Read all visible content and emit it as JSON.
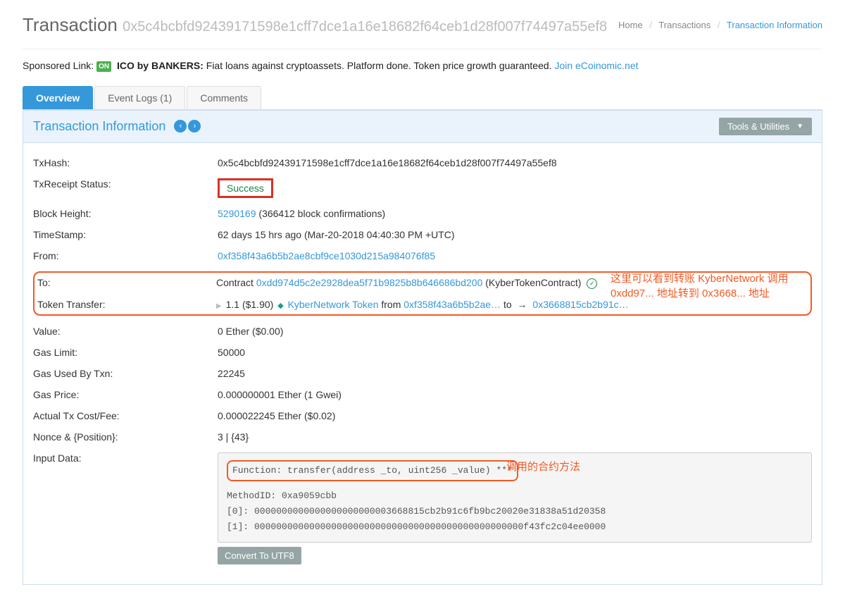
{
  "header": {
    "title_prefix": "Transaction",
    "hash": "0x5c4bcbfd92439171598e1cff7dce1a16e18682f64ceb1d28f007f74497a55ef8"
  },
  "breadcrumb": {
    "home": "Home",
    "transactions": "Transactions",
    "current": "Transaction Information"
  },
  "sponsored": {
    "label": "Sponsored Link:",
    "icon_text": "ON",
    "bold": "ICO by BANKERS:",
    "text": " Fiat loans against cryptoassets. Platform done. Token price growth guaranteed.",
    "link_text": "Join eCoinomic.net"
  },
  "tabs": {
    "overview": "Overview",
    "event_logs": "Event Logs (1)",
    "comments": "Comments"
  },
  "panel": {
    "title": "Transaction Information",
    "tools": "Tools & Utilities"
  },
  "fields": {
    "txhash_label": "TxHash:",
    "txhash_value": "0x5c4bcbfd92439171598e1cff7dce1a16e18682f64ceb1d28f007f74497a55ef8",
    "status_label": "TxReceipt Status:",
    "status_value": "Success",
    "block_label": "Block Height:",
    "block_link": "5290169",
    "block_conf": " (366412 block confirmations)",
    "time_label": "TimeStamp:",
    "time_value": "62 days 15 hrs ago (Mar-20-2018 04:40:30 PM +UTC)",
    "from_label": "From:",
    "from_value": "0xf358f43a6b5b2ae8cbf9ce1030d215a984076f85",
    "to_label": "To:",
    "to_prefix": "Contract ",
    "to_addr": "0xdd974d5c2e2928dea5f71b9825b8b646686bd200",
    "to_suffix": " (KyberTokenContract) ",
    "transfer_label": "Token Transfer:",
    "transfer_amount": " 1.1 ($1.90) ",
    "transfer_token": "KyberNetwork Token",
    "transfer_from_word": "  from ",
    "transfer_from": "0xf358f43a6b5b2ae…",
    "transfer_to_word": " to ",
    "transfer_to": "0x3668815cb2b91c…",
    "value_label": "Value:",
    "value_value": "0 Ether ($0.00)",
    "gaslimit_label": "Gas Limit:",
    "gaslimit_value": "50000",
    "gasused_label": "Gas Used By Txn:",
    "gasused_value": "22245",
    "gasprice_label": "Gas Price:",
    "gasprice_value": "0.000000001 Ether (1 Gwei)",
    "cost_label": "Actual Tx Cost/Fee:",
    "cost_value": "0.000022245 Ether ($0.02)",
    "nonce_label": "Nonce & {Position}:",
    "nonce_value": "3 | {43}",
    "input_label": "Input Data:"
  },
  "input_data": {
    "function_line": "Function: transfer(address _to, uint256 _value) ***",
    "method": "MethodID: 0xa9059cbb",
    "arg0": "[0]:  0000000000000000000000003668815cb2b91c6fb9bc20020e31838a51d20358",
    "arg1": "[1]:  0000000000000000000000000000000000000000000000000f43fc2c04ee0000",
    "convert": "Convert To UTF8"
  },
  "annotations": {
    "transfer_note": "这里可以看到转账 KyberNetwork 调用 0xdd97... 地址转到 0x3668... 地址",
    "method_note": "调用的合约方法"
  }
}
